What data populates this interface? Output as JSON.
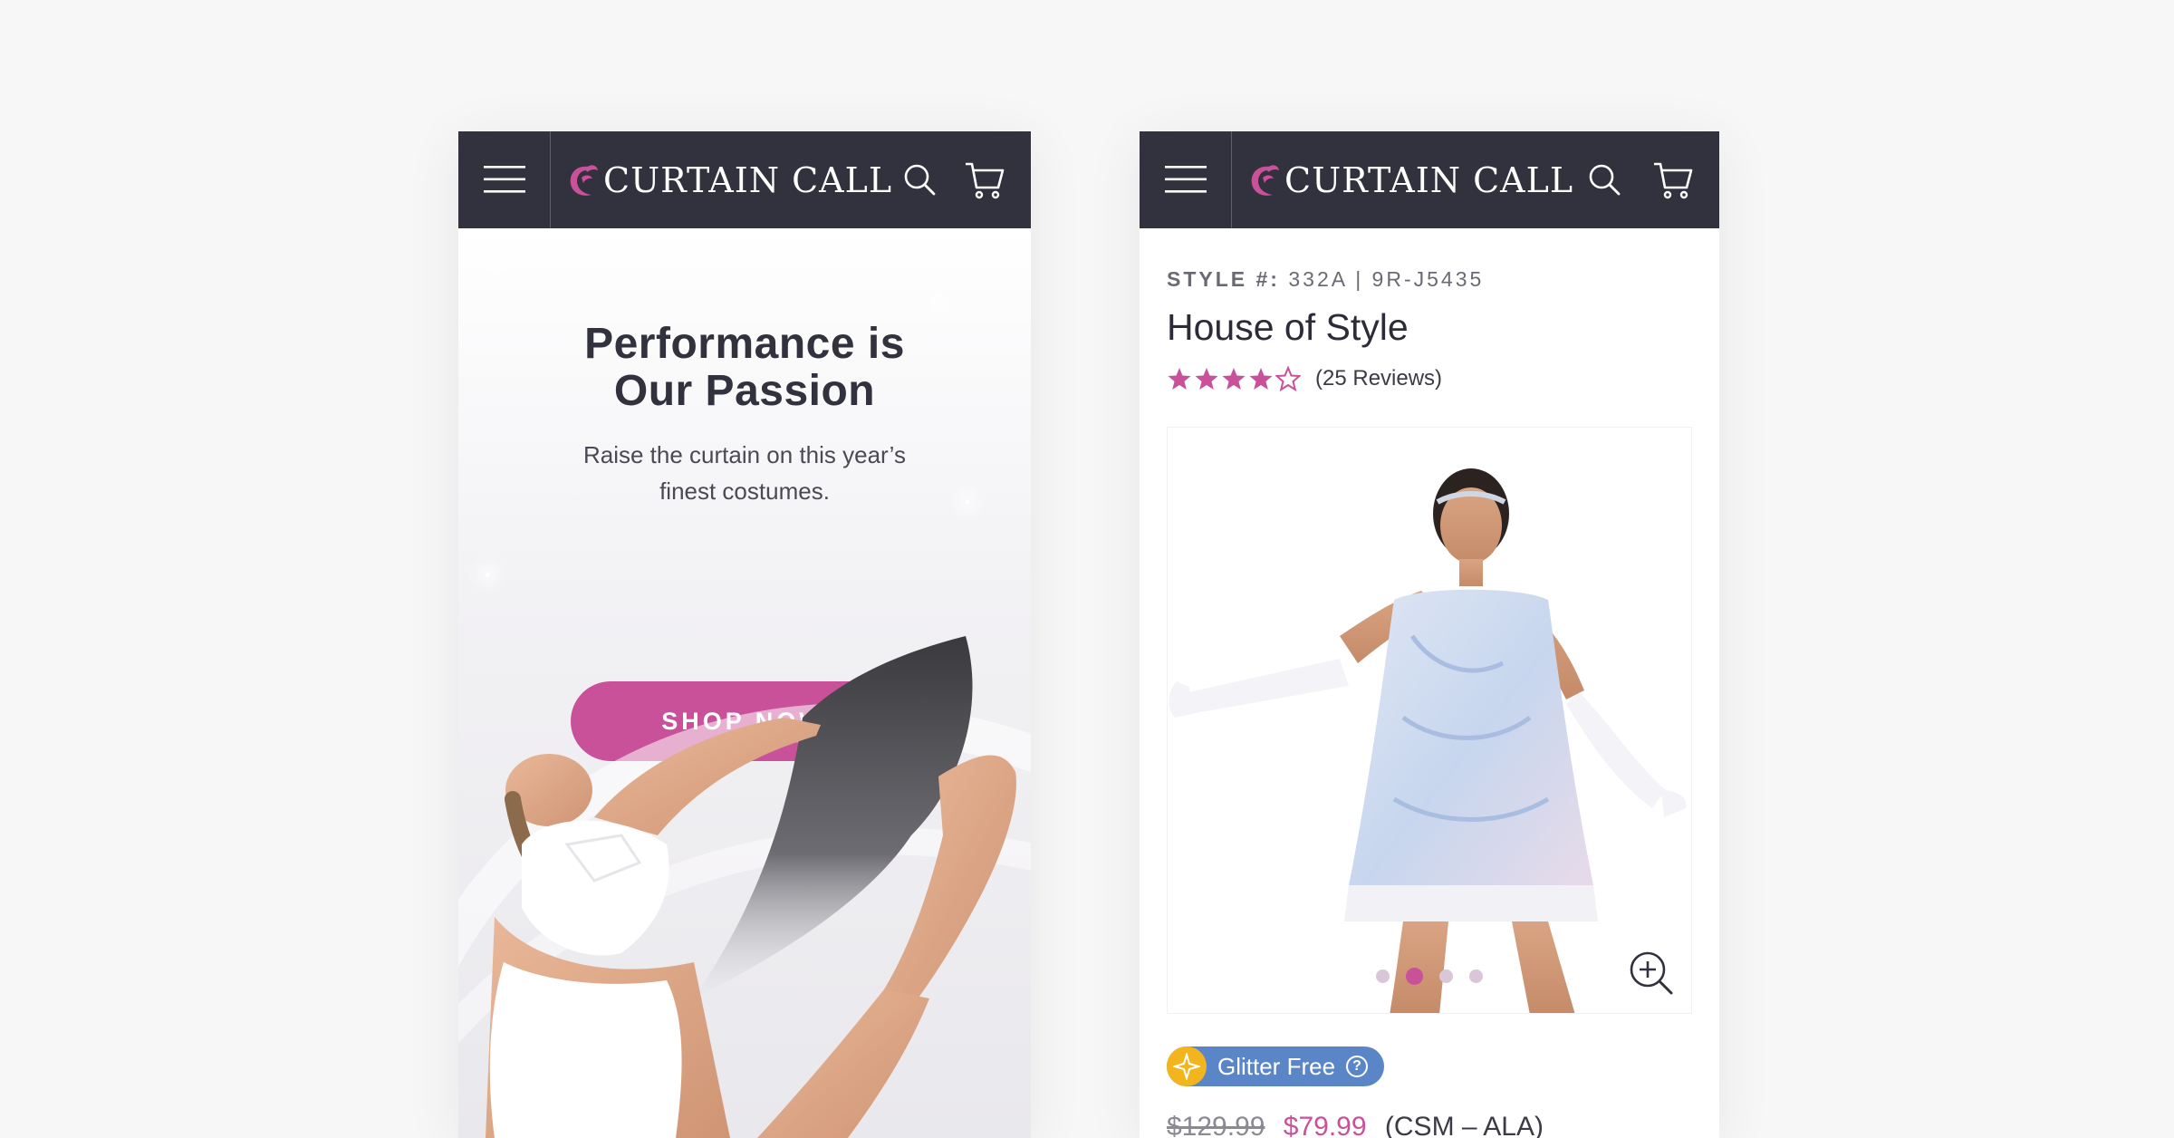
{
  "colors": {
    "header_bg": "#32323f",
    "brand_pink": "#c9519a",
    "badge_blue": "#5a86c8",
    "badge_gold": "#f2b51d",
    "page_bg": "#f7f7f8"
  },
  "brand": {
    "logo_text": "CURTAIN CALL"
  },
  "icons": {
    "menu": "hamburger-menu-icon",
    "search": "search-icon",
    "cart": "cart-icon",
    "zoom": "zoom-in-icon",
    "star": "star-icon",
    "help": "help-icon",
    "sparkle": "sparkle-icon"
  },
  "home": {
    "hero_title_line1": "Performance is",
    "hero_title_line2": "Our Passion",
    "hero_subtitle_line1": "Raise the curtain on this year’s",
    "hero_subtitle_line2": "finest costumes.",
    "cta_label": "SHOP NOW"
  },
  "product": {
    "style_label": "STYLE #:",
    "style_value": "332A | 9R-J5435",
    "title": "House of Style",
    "rating": 4,
    "rating_max": 5,
    "reviews_text": "(25 Reviews)",
    "carousel": {
      "count": 4,
      "active_index": 1
    },
    "badge_text": "Glitter Free",
    "badge_help": "?",
    "price_original": "$129.99",
    "price_sale": "$79.99",
    "size_range": "(CSM – ALA)"
  }
}
